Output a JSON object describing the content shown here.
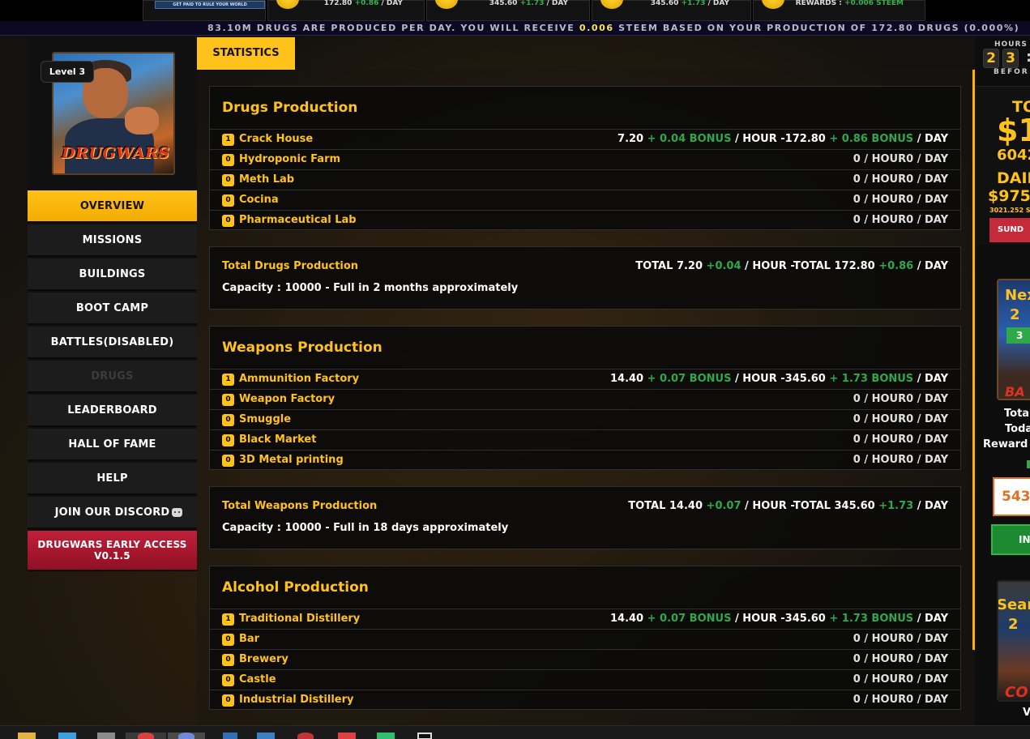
{
  "topbar": {
    "logo_text": "GET PAID TO RULE YOUR WORLD",
    "boxes": [
      {
        "main": "172.80",
        "bonus": "+0.86",
        "unit": "/ DAY"
      },
      {
        "main": "345.60",
        "bonus": "+1.73",
        "unit": "/ DAY"
      },
      {
        "main": "345.60",
        "bonus": "+1.73",
        "unit": "/ DAY"
      },
      {
        "main": "REWARDS :",
        "bonus": "+0.006 STEEM",
        "unit": ""
      }
    ]
  },
  "ticker": {
    "part1": "83.10M DRUGS ARE PRODUCED PER DAY. YOU WILL RECEIVE",
    "highlight": "0.006",
    "part2": "STEEM BASED ON YOUR PRODUCTION OF 172.80 DRUGS (0.000%)"
  },
  "profile": {
    "level": "Level 3",
    "logo_text": "DRUGWARS"
  },
  "nav": [
    {
      "label": "OVERVIEW"
    },
    {
      "label": "MISSIONS"
    },
    {
      "label": "BUILDINGS"
    },
    {
      "label": "BOOT CAMP"
    },
    {
      "label": "BATTLES(DISABLED)"
    },
    {
      "label": "DRUGS"
    },
    {
      "label": "LEADERBOARD"
    },
    {
      "label": "HALL OF FAME"
    },
    {
      "label": "HELP"
    },
    {
      "label": "JOIN OUR DISCORD"
    },
    {
      "label": "DRUGWARS EARLY ACCESS V0.1.5"
    }
  ],
  "tab": {
    "label": "STATISTICS"
  },
  "labels": {
    "bonus": "BONUS",
    "hour": "/ HOUR",
    "day": "/ DAY",
    "zero_row": "0 / HOUR0 / DAY",
    "total": "TOTAL"
  },
  "drugs": {
    "title": "Drugs Production",
    "rows": [
      {
        "count": "1",
        "name": "Crack House",
        "hour": "7.20",
        "hour_bonus": "+ 0.04",
        "day": "-172.80",
        "day_bonus": "+ 0.86"
      },
      {
        "count": "0",
        "name": "Hydroponic Farm"
      },
      {
        "count": "0",
        "name": "Meth Lab"
      },
      {
        "count": "0",
        "name": "Cocina"
      },
      {
        "count": "0",
        "name": "Pharmaceutical Lab"
      }
    ],
    "total_title": "Total Drugs Production",
    "total_hour": "7.20",
    "total_hour_bonus": "+0.04",
    "total_day": "-TOTAL 172.80",
    "total_day_bonus": "+0.86",
    "capacity": "Capacity : 10000 - Full in 2 months approximately"
  },
  "weapons": {
    "title": "Weapons Production",
    "rows": [
      {
        "count": "1",
        "name": "Ammunition Factory",
        "hour": "14.40",
        "hour_bonus": "+ 0.07",
        "day": "-345.60",
        "day_bonus": "+ 1.73"
      },
      {
        "count": "0",
        "name": "Weapon Factory"
      },
      {
        "count": "0",
        "name": "Smuggle"
      },
      {
        "count": "0",
        "name": "Black Market"
      },
      {
        "count": "0",
        "name": "3D Metal printing"
      }
    ],
    "total_title": "Total Weapons Production",
    "total_hour": "14.40",
    "total_hour_bonus": "+0.07",
    "total_day": "-TOTAL 345.60",
    "total_day_bonus": "+1.73",
    "capacity": "Capacity : 10000 - Full in 18 days approximately"
  },
  "alcohol": {
    "title": "Alcohol Production",
    "rows": [
      {
        "count": "1",
        "name": "Traditional Distillery",
        "hour": "14.40",
        "hour_bonus": "+ 0.07",
        "day": "-345.60",
        "day_bonus": "+ 1.73"
      },
      {
        "count": "0",
        "name": "Bar"
      },
      {
        "count": "0",
        "name": "Brewery"
      },
      {
        "count": "0",
        "name": "Castle"
      },
      {
        "count": "0",
        "name": "Industrial Distillery"
      }
    ]
  },
  "right": {
    "hours_label": "HOURS",
    "digits": [
      "2",
      "3"
    ],
    "before_label": "BEFOR",
    "promo_to": "TO",
    "promo_big": "$1",
    "promo_num": "6042",
    "promo_daily": "DAIL",
    "promo_daily_val": "$975.",
    "promo_small": "3021.252 ST",
    "promo_btn": "SUND",
    "next_text": "Nex",
    "next_num": "2",
    "next_green": "3",
    "next_ba": "BA",
    "total_label": "Total",
    "today_label": "Toda",
    "reward_label": "Reward",
    "input_value": "543",
    "btn_label": "IN",
    "search_text": "Sear",
    "search_num": "2",
    "search_co": "CO",
    "last_char": "V"
  },
  "colors": {
    "accent": "#ffc21a",
    "bonus_green": "#2fa84a",
    "early_access": "#c1203a",
    "ticker_highlight": "#ffe74a"
  }
}
